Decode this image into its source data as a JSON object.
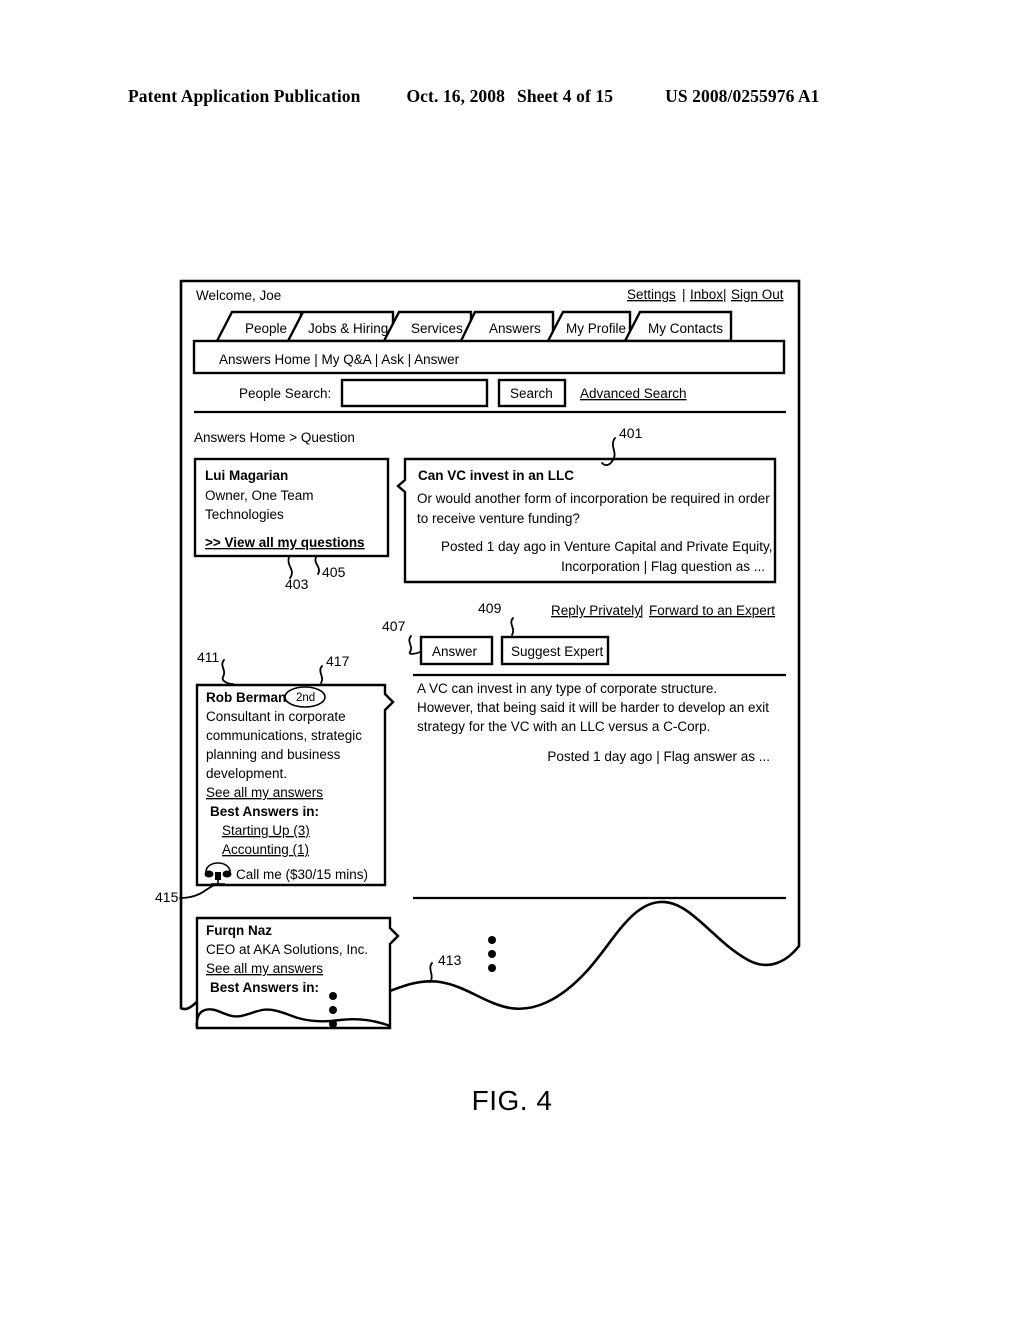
{
  "patent_header": {
    "publication": "Patent Application Publication",
    "date": "Oct. 16, 2008",
    "sheet": "Sheet 4 of 15",
    "number": "US 2008/0255976 A1"
  },
  "figure": {
    "caption": "FIG. 4"
  },
  "app": {
    "welcome": "Welcome, Joe",
    "account_links": [
      {
        "label": "Settings"
      },
      {
        "label": "Inbox"
      },
      {
        "label": "Sign Out"
      }
    ],
    "account_separator": "|",
    "tabs": [
      {
        "label": "People",
        "active": false
      },
      {
        "label": "Jobs & Hiring",
        "active": false
      },
      {
        "label": "Services",
        "active": false
      },
      {
        "label": "Answers",
        "active": true
      },
      {
        "label": "My Profile",
        "active": false
      },
      {
        "label": "My Contacts",
        "active": false
      }
    ],
    "subnav": {
      "items": [
        "Answers Home",
        "My Q&A",
        "Ask",
        "Answer"
      ],
      "separator": "|",
      "full_text": "Answers Home | My Q&A | Ask | Answer"
    },
    "search": {
      "label": "People Search:",
      "value": "",
      "placeholder": "",
      "button": "Search",
      "advanced_link": "Advanced Search"
    },
    "breadcrumb": "Answers Home > Question"
  },
  "asker_card": {
    "name": "Lui Magarian",
    "title_line1": "Owner, One Team",
    "title_line2": "Technologies",
    "view_all_link": ">> View all my questions"
  },
  "question": {
    "title": "Can VC invest in an LLC",
    "body_line1": "Or would another form of incorporation be required in order",
    "body_line2": "to receive venture funding?",
    "meta_line1": "Posted 1 day ago in Venture Capital and Private Equity,",
    "meta_line2": "Incorporation | Flag question as ..."
  },
  "actions": {
    "answer_button": "Answer",
    "suggest_expert_button": "Suggest Expert",
    "reply_privately_link": "Reply Privately",
    "link_separator": "|",
    "forward_expert_link": "Forward to an Expert"
  },
  "answer": {
    "body_line1": "A VC can invest in any type of corporate structure.",
    "body_line2": "However, that being said it will be harder to develop an exit",
    "body_line3": "strategy for the VC with an LLC versus a C-Corp.",
    "meta": "Posted 1 day ago | Flag answer as ..."
  },
  "answerer_card": {
    "name": "Rob Berman",
    "degree_badge": "2nd",
    "bio_line1": "Consultant in corporate",
    "bio_line2": "communications, strategic",
    "bio_line3": "planning and business",
    "bio_line4": "development.",
    "see_all_link": "See all my answers",
    "best_answers_label": "Best Answers in:",
    "best_answers": [
      {
        "label": "Starting Up (3)"
      },
      {
        "label": "Accounting (1)"
      }
    ],
    "call_icon": "telephone-icon",
    "call_label": "Call me ($30/15 mins)"
  },
  "answerer_card_2": {
    "name": "Furqn Naz",
    "bio_line1": "CEO at AKA Solutions, Inc.",
    "see_all_link": "See all my answers",
    "best_answers_label": "Best Answers in:"
  },
  "reference_numerals": {
    "r401": "401",
    "r403": "403",
    "r405": "405",
    "r407": "407",
    "r409": "409",
    "r411": "411",
    "r413": "413",
    "r415": "415",
    "r417": "417"
  }
}
